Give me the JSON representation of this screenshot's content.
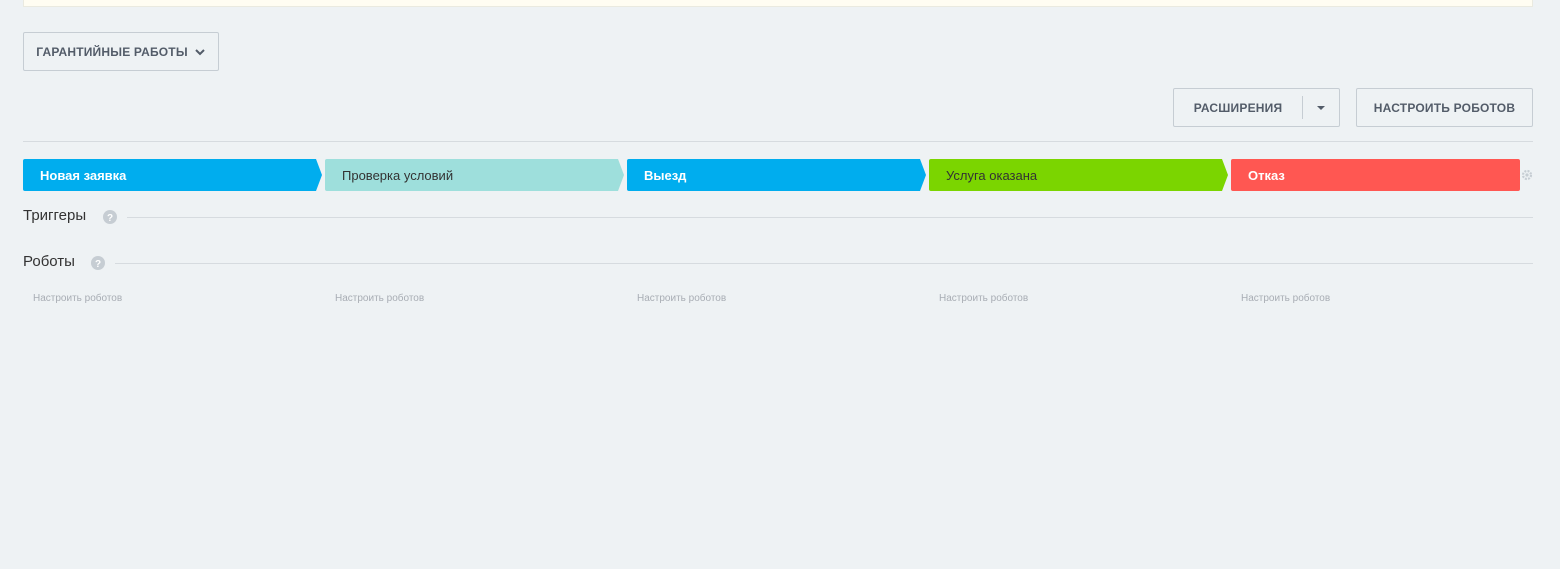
{
  "category": {
    "label": "ГАРАНТИЙНЫЕ РАБОТЫ"
  },
  "toolbar": {
    "extensions_label": "РАСШИРЕНИЯ",
    "robots_label": "НАСТРОИТЬ РОБОТОВ"
  },
  "stages": [
    {
      "label": "Новая заявка",
      "color": "#00adee",
      "text_color": "#ffffff"
    },
    {
      "label": "Проверка условий",
      "color": "#9edfdc",
      "text_color": "#333333"
    },
    {
      "label": "Выезд",
      "color": "#00adee",
      "text_color": "#ffffff"
    },
    {
      "label": "Услуга оказана",
      "color": "#7bd500",
      "text_color": "#333333"
    },
    {
      "label": "Отказ",
      "color": "#ff5752",
      "text_color": "#ffffff"
    }
  ],
  "sections": {
    "triggers_title": "Триггеры",
    "robots_title": "Роботы"
  },
  "robot_links": [
    "Настроить роботов",
    "Настроить роботов",
    "Настроить роботов",
    "Настроить роботов",
    "Настроить роботов"
  ]
}
